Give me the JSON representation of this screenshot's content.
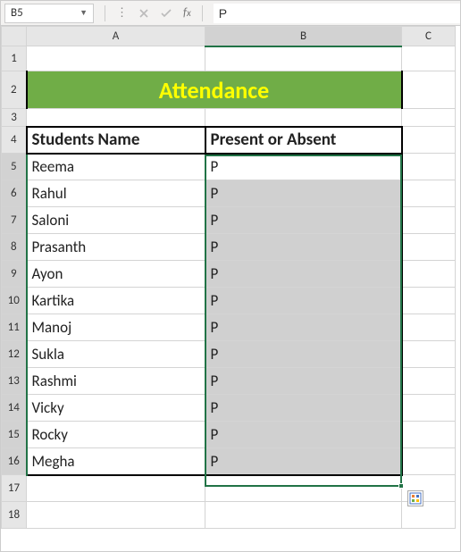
{
  "namebox": {
    "value": "B5"
  },
  "formula_bar": {
    "fx_label": "fx",
    "value": "P"
  },
  "columns": [
    "A",
    "B",
    "C"
  ],
  "rows": [
    "1",
    "2",
    "3",
    "4",
    "5",
    "6",
    "7",
    "8",
    "9",
    "10",
    "11",
    "12",
    "13",
    "14",
    "15",
    "16",
    "17",
    "18"
  ],
  "title": "Attendance",
  "headers": {
    "col_a": "Students Name",
    "col_b": "Present or Absent"
  },
  "data": [
    {
      "name": "Reema",
      "status": "P"
    },
    {
      "name": "Rahul",
      "status": "P"
    },
    {
      "name": "Saloni",
      "status": "P"
    },
    {
      "name": "Prasanth",
      "status": "P"
    },
    {
      "name": "Ayon",
      "status": "P"
    },
    {
      "name": "Kartika",
      "status": "P"
    },
    {
      "name": "Manoj",
      "status": "P"
    },
    {
      "name": "Sukla",
      "status": "P"
    },
    {
      "name": "Rashmi",
      "status": "P"
    },
    {
      "name": "Vicky",
      "status": "P"
    },
    {
      "name": "Rocky",
      "status": "P"
    },
    {
      "name": "Megha",
      "status": "P"
    }
  ],
  "selection": {
    "active": "B5",
    "range": "B5:B16",
    "col": "B"
  }
}
